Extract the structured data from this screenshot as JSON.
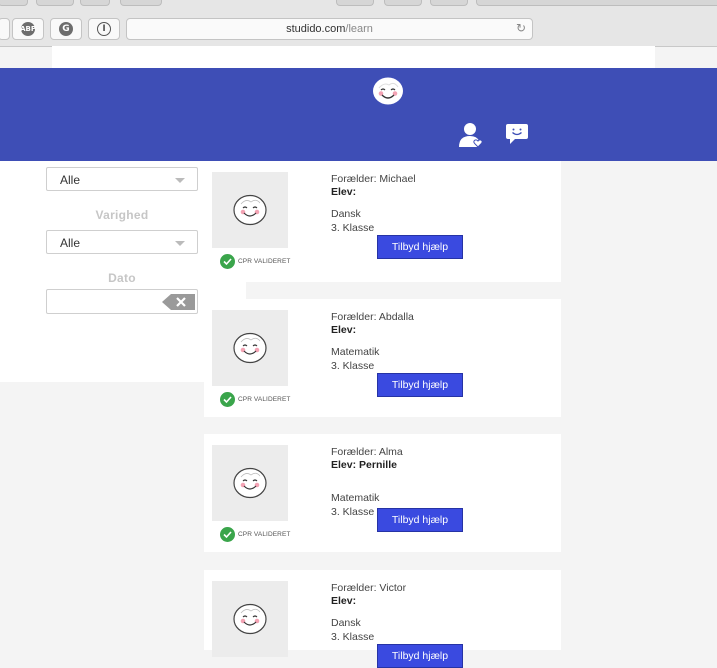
{
  "browser": {
    "extensions": {
      "adblock": "ABP",
      "ghostery": "G",
      "info": "I"
    },
    "url": {
      "host": "studido.com",
      "path": "/learn"
    }
  },
  "header": {
    "logo": "smiley-logo",
    "icons": [
      "user-heart-icon",
      "chat-bubble-icon"
    ]
  },
  "filters": {
    "first_select": "Alle",
    "duration": {
      "label": "Varighed",
      "value": "Alle"
    },
    "date": {
      "label": "Dato",
      "value": ""
    }
  },
  "requests": [
    {
      "parent": "Forælder: Michael",
      "student": "Elev:",
      "subject": "Dansk",
      "grade": "3. Klasse",
      "cpr": "CPR VALIDERET",
      "button": "Tilbyd hjælp"
    },
    {
      "parent": "Forælder: Abdalla",
      "student": "Elev:",
      "subject": "Matematik",
      "grade": "3. Klasse",
      "cpr": "CPR VALIDERET",
      "button": "Tilbyd hjælp"
    },
    {
      "parent": "Forælder: Alma",
      "student": "Elev: Pernille",
      "subject": "Matematik",
      "grade": "3. Klasse",
      "cpr": "CPR VALIDERET",
      "button": "Tilbyd hjælp"
    },
    {
      "parent": "Forælder: Victor",
      "student": "Elev:",
      "subject": "Dansk",
      "grade": "3. Klasse",
      "cpr": "",
      "button": "Tilbyd hjælp"
    }
  ],
  "colors": {
    "header": "#3e4eb6",
    "button": "#3a4ae0",
    "verified": "#3aa54b"
  }
}
